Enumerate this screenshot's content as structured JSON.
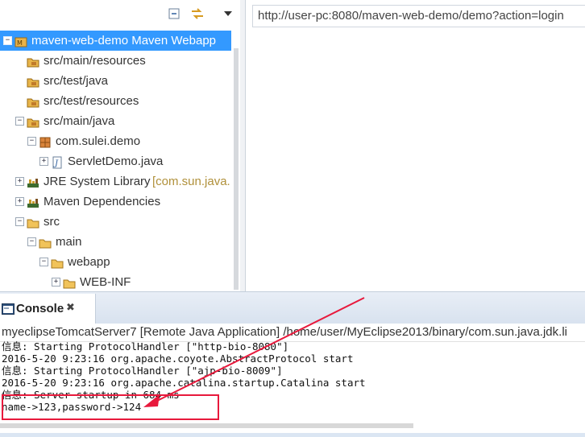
{
  "explorer": {
    "tree": [
      {
        "label": "maven-web-demo Maven Webapp",
        "expander": "−",
        "icon": "project-icon",
        "selected": true
      },
      {
        "label": "src/main/resources",
        "expander": "",
        "icon": "package-folder-icon"
      },
      {
        "label": "src/test/java",
        "expander": "",
        "icon": "package-folder-icon"
      },
      {
        "label": "src/test/resources",
        "expander": "",
        "icon": "package-folder-icon"
      },
      {
        "label": "src/main/java",
        "expander": "−",
        "icon": "package-folder-icon"
      },
      {
        "label": "com.sulei.demo",
        "expander": "−",
        "icon": "package-icon"
      },
      {
        "label": "ServletDemo.java",
        "expander": "+",
        "icon": "java-file-icon"
      },
      {
        "label": "JRE System Library",
        "suffix": "[com.sun.java.",
        "expander": "+",
        "icon": "library-icon"
      },
      {
        "label": "Maven Dependencies",
        "expander": "+",
        "icon": "library-icon"
      },
      {
        "label": "src",
        "expander": "−",
        "icon": "folder-icon"
      },
      {
        "label": "main",
        "expander": "−",
        "icon": "folder-icon"
      },
      {
        "label": "webapp",
        "expander": "−",
        "icon": "folder-icon"
      },
      {
        "label": "WEB-INF",
        "expander": "+",
        "icon": "folder-icon"
      }
    ]
  },
  "browser": {
    "url": "http://user-pc:8080/maven-web-demo/demo?action=login"
  },
  "console": {
    "tab_label": "Console",
    "close_glyph": "✖",
    "header": "myeclipseTomcatServer7 [Remote Java Application] /home/user/MyEclipse2013/binary/com.sun.java.jdk.li",
    "lines": [
      "信息: Starting ProtocolHandler [\"http-bio-8080\"]",
      "2016-5-20 9:23:16 org.apache.coyote.AbstractProtocol start",
      "信息: Starting ProtocolHandler [\"ajp-bio-8009\"]",
      "2016-5-20 9:23:16 org.apache.catalina.startup.Catalina start",
      "信息: Server startup in 684 ms",
      "name->123,password->124"
    ]
  },
  "colors": {
    "selection": "#3399ff",
    "annotation": "#e8193c"
  }
}
